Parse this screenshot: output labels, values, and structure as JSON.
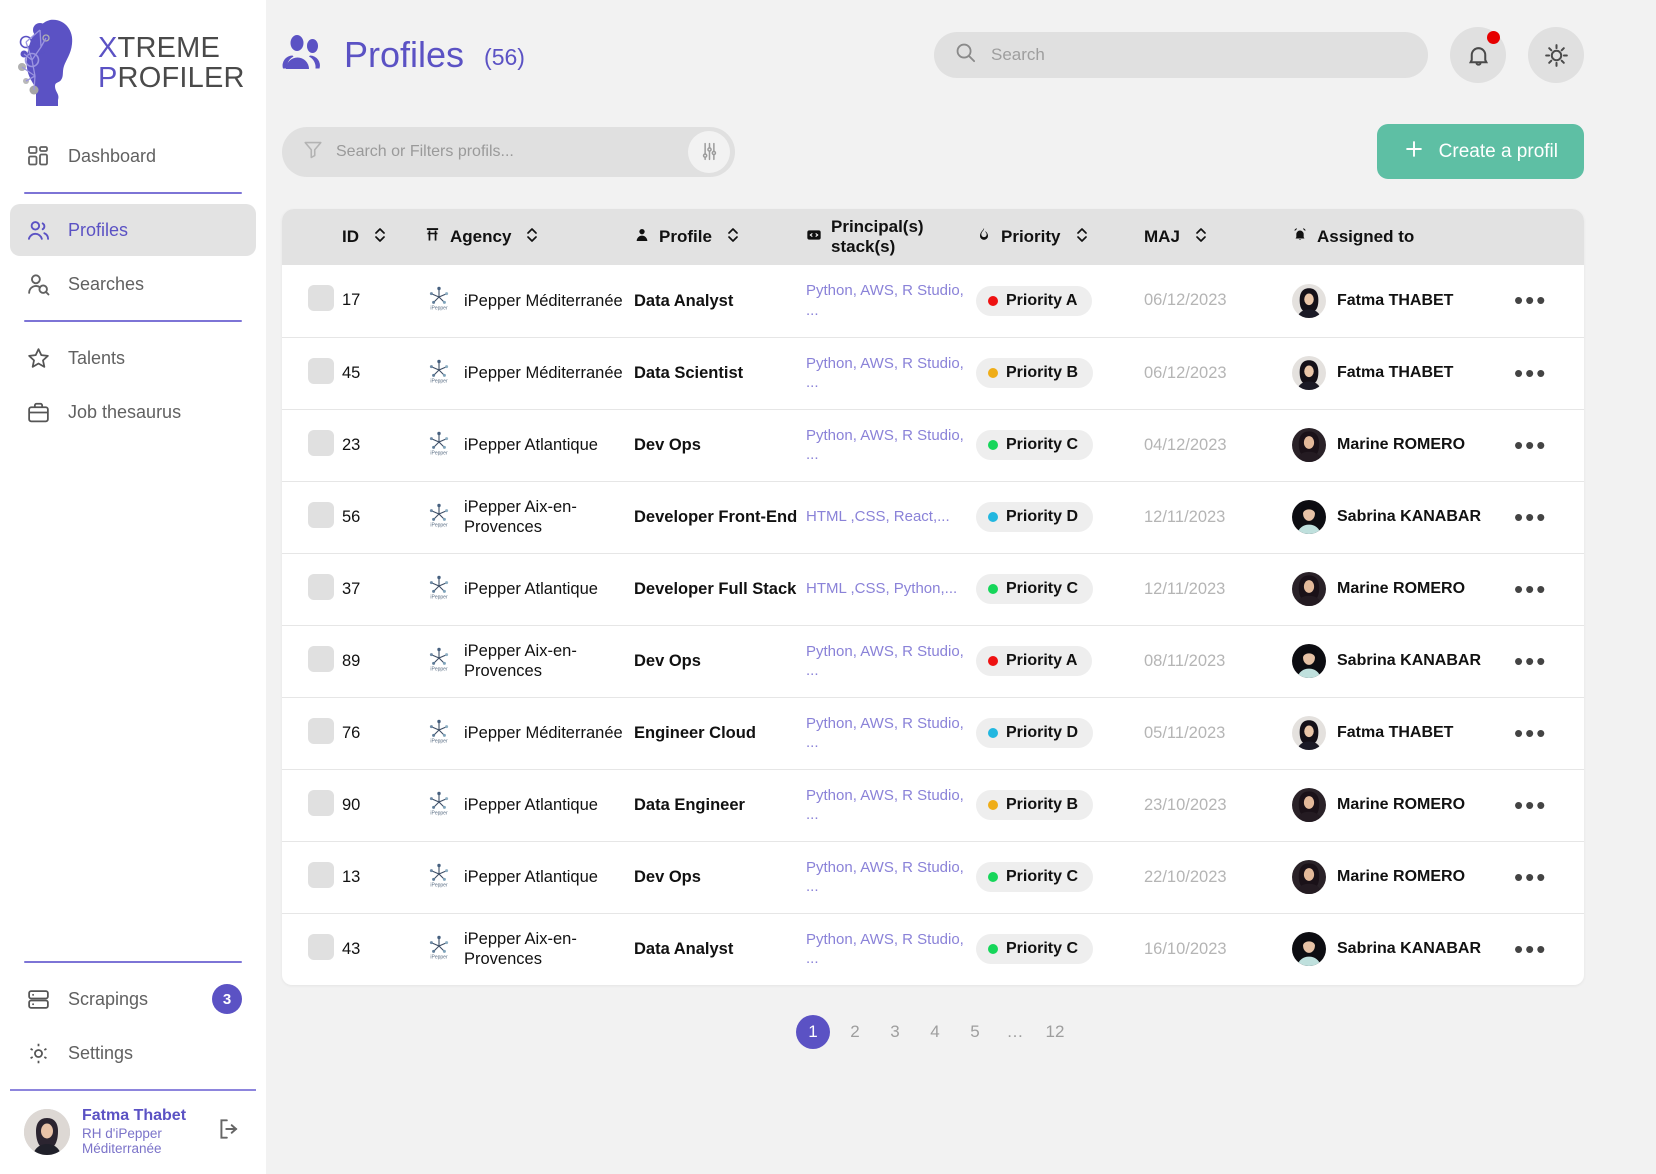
{
  "brand": {
    "line1_a": "X",
    "line1_b": "TREME",
    "line2_a": "P",
    "line2_b": "ROFILER"
  },
  "sidebar": {
    "items": [
      {
        "label": "Dashboard",
        "icon": "dashboard-icon",
        "active": false
      },
      {
        "label": "Profiles",
        "icon": "profiles-icon",
        "active": true
      },
      {
        "label": "Searches",
        "icon": "searches-icon",
        "active": false
      },
      {
        "label": "Talents",
        "icon": "star-icon",
        "active": false
      },
      {
        "label": "Job thesaurus",
        "icon": "briefcase-icon",
        "active": false
      }
    ],
    "bottom_items": [
      {
        "label": "Scrapings",
        "icon": "server-icon",
        "badge": "3"
      },
      {
        "label": "Settings",
        "icon": "gear-icon",
        "badge": ""
      }
    ],
    "user": {
      "name": "Fatma Thabet",
      "role": "RH d'iPepper Méditerranée"
    }
  },
  "header": {
    "title": "Profiles",
    "count": "(56)",
    "search_placeholder": "Search",
    "search_value": "",
    "notification_badge": true
  },
  "toolbar": {
    "filter_placeholder": "Search or Filters profils...",
    "filter_value": "",
    "create_label": "Create a profil",
    "create_color": "#5ebfa4"
  },
  "table": {
    "columns": [
      {
        "label": "ID",
        "icon": "",
        "sortable": true
      },
      {
        "label": "Agency",
        "icon": "building-icon",
        "sortable": true
      },
      {
        "label": "Profile",
        "icon": "person-icon",
        "sortable": true
      },
      {
        "label": "Principal(s) stack(s)",
        "icon": "code-icon",
        "sortable": false
      },
      {
        "label": "Priority",
        "icon": "flame-icon",
        "sortable": true
      },
      {
        "label": "MAJ",
        "icon": "",
        "sortable": true
      },
      {
        "label": "Assigned to",
        "icon": "bell-icon",
        "sortable": false
      }
    ],
    "rows": [
      {
        "id": "17",
        "agency": "iPepper Méditerranée",
        "profile": "Data Analyst",
        "stack": "Python, AWS, R Studio, ...",
        "priority": "Priority A",
        "priority_color": "#ee1111",
        "maj": "06/12/2023",
        "assigned": "Fatma THABET",
        "avatar": "fatma"
      },
      {
        "id": "45",
        "agency": "iPepper Méditerranée",
        "profile": "Data Scientist",
        "stack": "Python, AWS, R Studio, ...",
        "priority": "Priority B",
        "priority_color": "#efad18",
        "maj": "06/12/2023",
        "assigned": "Fatma THABET",
        "avatar": "fatma"
      },
      {
        "id": "23",
        "agency": "iPepper Atlantique",
        "profile": "Dev Ops",
        "stack": "Python, AWS, R Studio, ...",
        "priority": "Priority C",
        "priority_color": "#16d65a",
        "maj": "04/12/2023",
        "assigned": "Marine ROMERO",
        "avatar": "marine"
      },
      {
        "id": "56",
        "agency": "iPepper Aix-en-Provences",
        "profile": "Developer Front-End",
        "stack": "HTML ,CSS, React,...",
        "priority": "Priority D",
        "priority_color": "#22b7e0",
        "maj": "12/11/2023",
        "assigned": "Sabrina KANABAR",
        "avatar": "sabrina"
      },
      {
        "id": "37",
        "agency": "iPepper Atlantique",
        "profile": "Developer Full Stack",
        "stack": "HTML ,CSS, Python,...",
        "priority": "Priority C",
        "priority_color": "#16d65a",
        "maj": "12/11/2023",
        "assigned": "Marine ROMERO",
        "avatar": "marine"
      },
      {
        "id": "89",
        "agency": "iPepper Aix-en-Provences",
        "profile": "Dev Ops",
        "stack": "Python, AWS, R Studio, ...",
        "priority": "Priority A",
        "priority_color": "#ee1111",
        "maj": "08/11/2023",
        "assigned": "Sabrina KANABAR",
        "avatar": "sabrina"
      },
      {
        "id": "76",
        "agency": "iPepper Méditerranée",
        "profile": "Engineer Cloud",
        "stack": "Python, AWS, R Studio, ...",
        "priority": "Priority D",
        "priority_color": "#22b7e0",
        "maj": "05/11/2023",
        "assigned": "Fatma THABET",
        "avatar": "fatma"
      },
      {
        "id": "90",
        "agency": "iPepper Atlantique",
        "profile": "Data Engineer",
        "stack": "Python, AWS, R Studio, ...",
        "priority": "Priority B",
        "priority_color": "#efad18",
        "maj": "23/10/2023",
        "assigned": "Marine ROMERO",
        "avatar": "marine"
      },
      {
        "id": "13",
        "agency": "iPepper Atlantique",
        "profile": "Dev Ops",
        "stack": "Python, AWS, R Studio, ...",
        "priority": "Priority C",
        "priority_color": "#16d65a",
        "maj": "22/10/2023",
        "assigned": "Marine ROMERO",
        "avatar": "marine"
      },
      {
        "id": "43",
        "agency": "iPepper Aix-en-Provences",
        "profile": "Data Analyst",
        "stack": "Python, AWS, R Studio, ...",
        "priority": "Priority C",
        "priority_color": "#16d65a",
        "maj": "16/10/2023",
        "assigned": "Sabrina KANABAR",
        "avatar": "sabrina"
      }
    ],
    "row_menu_label": "•••"
  },
  "pagination": {
    "pages": [
      "1",
      "2",
      "3",
      "4",
      "5",
      "…",
      "12"
    ],
    "current": "1"
  }
}
